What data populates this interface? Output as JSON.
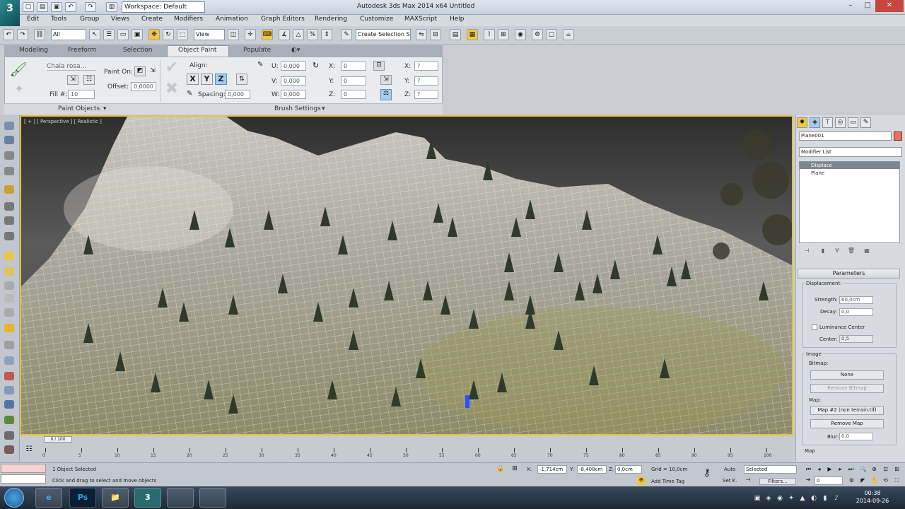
{
  "app": {
    "logo": "3",
    "workspace": "Workspace: Default",
    "title": "Autodesk 3ds Max  2014 x64      Untitled",
    "window_controls": [
      "–",
      "□",
      "✕"
    ]
  },
  "menu": [
    "Edit",
    "Tools",
    "Group",
    "Views",
    "Create",
    "Modifiers",
    "Animation",
    "Graph Editors",
    "Rendering",
    "Customize",
    "MAXScript",
    "Help"
  ],
  "toolbar": {
    "filter": "All",
    "view_dropdown": "View",
    "selection_set": "Create Selection S"
  },
  "ribbon": {
    "tabs": [
      "Modeling",
      "Freeform",
      "Selection",
      "Object Paint",
      "Populate"
    ],
    "active_tab": "Object Paint",
    "paint_objects": {
      "brush_dropdown": "Chaia rosa...",
      "paint_on_label": "Paint On:",
      "offset_label": "Offset:",
      "offset_value": "0,0000",
      "fill_label": "Fill #:",
      "fill_value": "10",
      "section_label": "Paint Objects"
    },
    "brush_settings": {
      "align_label": "Align:",
      "axes": [
        "X",
        "Y",
        "Z"
      ],
      "active_axis": "Z",
      "spacing_label": "Spacing:",
      "spacing_value": "0,000",
      "u_label": "U:",
      "u_value": "0,000",
      "v_label": "V:",
      "v_value": "0,000",
      "w_label": "W:",
      "w_value": "0,000",
      "x_label": "X:",
      "x_value": "0",
      "y_label": "Y:",
      "y_value": "0",
      "z_label": "Z:",
      "z_value": "0",
      "sx_label": "X:",
      "sx_value": "?",
      "sy_label": "Y:",
      "sy_value": "?",
      "sz_label": "Z:",
      "sz_value": "?",
      "section_label": "Brush Settings"
    }
  },
  "viewport": {
    "label": "[ + ] [ Perspective ] [ Realistic ]"
  },
  "command_panel": {
    "object_name": "Plane001",
    "object_color": "#e6735c",
    "modifier_list": "Modifier List",
    "stack": [
      "Displace",
      "Plane"
    ],
    "parameters_title": "Parameters",
    "displacement_label": "Displacement:",
    "strength_label": "Strength:",
    "strength_value": "60,0cm",
    "decay_label": "Decay:",
    "decay_value": "0,0",
    "luminance_center_label": "Luminance Center",
    "center_label": "Center:",
    "center_value": "0,5",
    "image_label": "Image",
    "bitmap_label": "Bitmap:",
    "bitmap_button": "None",
    "remove_bitmap_button": "Remove Bitmap",
    "map_label": "Map:",
    "map_button": "Map #2 (non terrain.tif)",
    "remove_map_button": "Remove Map",
    "blur_label": "Blur:",
    "blur_value": "0,0",
    "map_section_label": "Map"
  },
  "timeline": {
    "slider_label": "0 / 100",
    "ticks": [
      "0",
      "5",
      "10",
      "15",
      "20",
      "25",
      "30",
      "35",
      "40",
      "45",
      "50",
      "55",
      "60",
      "65",
      "70",
      "75",
      "80",
      "85",
      "90",
      "95",
      "100"
    ]
  },
  "status": {
    "selection": "1 Object Selected",
    "prompt": "Click and drag to select and move objects",
    "x_value": "-1,714cm",
    "y_value": "-8,408cm",
    "z_value": "0,0cm",
    "grid": "Grid = 10,0cm",
    "add_time_tag": "Add Time Tag",
    "auto_label": "Auto",
    "set_k_label": "Set K.",
    "key_filter": "Selected",
    "filters_button": "Filters...",
    "frame_value": "0"
  },
  "taskbar": {
    "clock_time": "00:38",
    "clock_date": "2014-09-26",
    "apps": [
      "e",
      "Ps",
      "📁",
      "3",
      "",
      ""
    ]
  }
}
